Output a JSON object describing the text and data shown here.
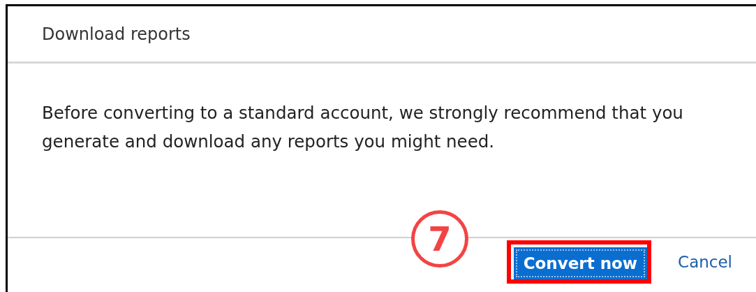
{
  "dialog": {
    "title": "Download reports",
    "message": "Before converting to a standard account, we strongly recommend that you generate and download any reports you might need.",
    "buttons": [
      {
        "label": "Convert now",
        "kind": "primary",
        "highlighted": true
      },
      {
        "label": "Cancel",
        "kind": "link",
        "highlighted": false
      }
    ]
  },
  "callout": {
    "label": "7"
  }
}
